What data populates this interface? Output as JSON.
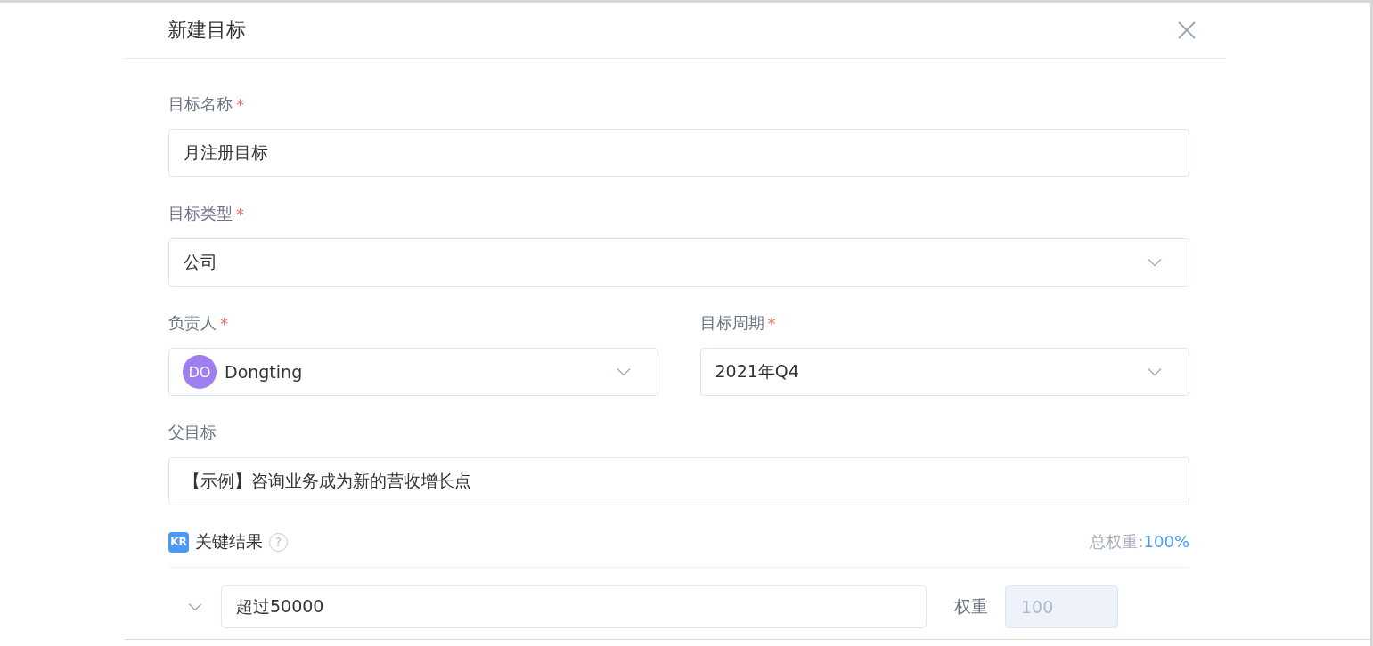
{
  "dialog": {
    "title": "新建目标"
  },
  "fields": [
    {
      "kind": "text",
      "label": "目标名称",
      "required_mark": "*",
      "value": "月注册目标"
    },
    {
      "kind": "select",
      "label": "目标类型",
      "required_mark": "*",
      "value": "公司"
    },
    {
      "kind": "row",
      "fields": [
        {
          "kind": "person-select",
          "label": "负责人",
          "required_mark": "*",
          "avatar": "DO",
          "value": "Dongting"
        },
        {
          "kind": "select",
          "label": "目标周期",
          "required_mark": "*",
          "value": "2021年Q4"
        }
      ]
    },
    {
      "kind": "text",
      "label": "父目标",
      "value": "【示例】咨询业务成为新的营收增长点"
    }
  ],
  "key_results": {
    "badge": "KR",
    "title": "关键结果",
    "help": "?",
    "total_label": "总权重:",
    "total_value": "100%",
    "items": [
      {
        "value": "超过50000",
        "weight_label": "权重",
        "weight": "100",
        "weight_disabled": true
      }
    ]
  }
}
